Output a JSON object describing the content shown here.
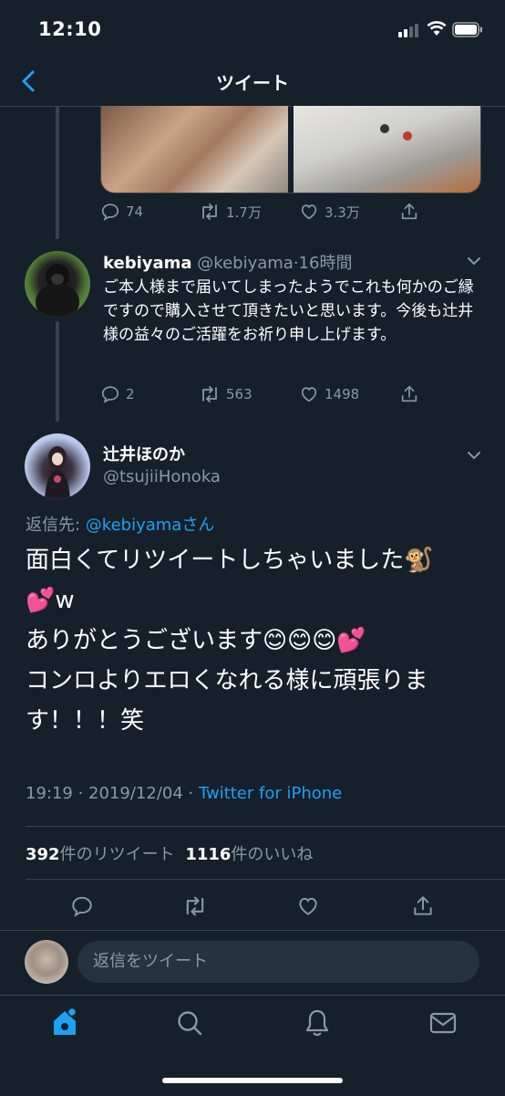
{
  "status_bar": {
    "time": "12:10"
  },
  "nav": {
    "title": "ツイート"
  },
  "parent_tweet_actions": {
    "replies": "74",
    "retweets": "1.7万",
    "likes": "3.3万"
  },
  "reply_tweet": {
    "name": "kebiyama",
    "handle": "@kebiyama",
    "time": "16時間",
    "text": "ご本人様まで届いてしまったようでこれも何かのご縁ですので購入させて頂きたいと思います。今後も辻井様の益々のご活躍をお祈り申し上げます。",
    "replies": "2",
    "retweets": "563",
    "likes": "1498"
  },
  "main_tweet": {
    "name": "辻井ほのか",
    "handle": "@tsujiiHonoka",
    "reply_to_prefix": "返信先: ",
    "reply_to_handle": "@kebiyamaさん",
    "text_line1": "面白くてリツイートしちゃいました🐒",
    "text_line2": "💕w",
    "text_line3": "ありがとうございます😊😊😊💕",
    "text_line4": "コンロよりエロくなれる様に頑張りま",
    "text_line5": "す！！！笑",
    "timestamp": "19:19 · 2019/12/04 · ",
    "source": "Twitter for iPhone",
    "retweet_count": "392",
    "retweet_label": "件のリツイート",
    "like_count": "1116",
    "like_label": "件のいいね"
  },
  "compose": {
    "placeholder": "返信をツイート"
  },
  "tabbar": {
    "icons": [
      "home-icon",
      "search-icon",
      "notifications-icon",
      "messages-icon"
    ],
    "active_color": "#1da1f2"
  },
  "colors": {
    "background": "#15202b",
    "muted": "#8899a6",
    "accent": "#1da1f2",
    "border": "#38444d"
  }
}
